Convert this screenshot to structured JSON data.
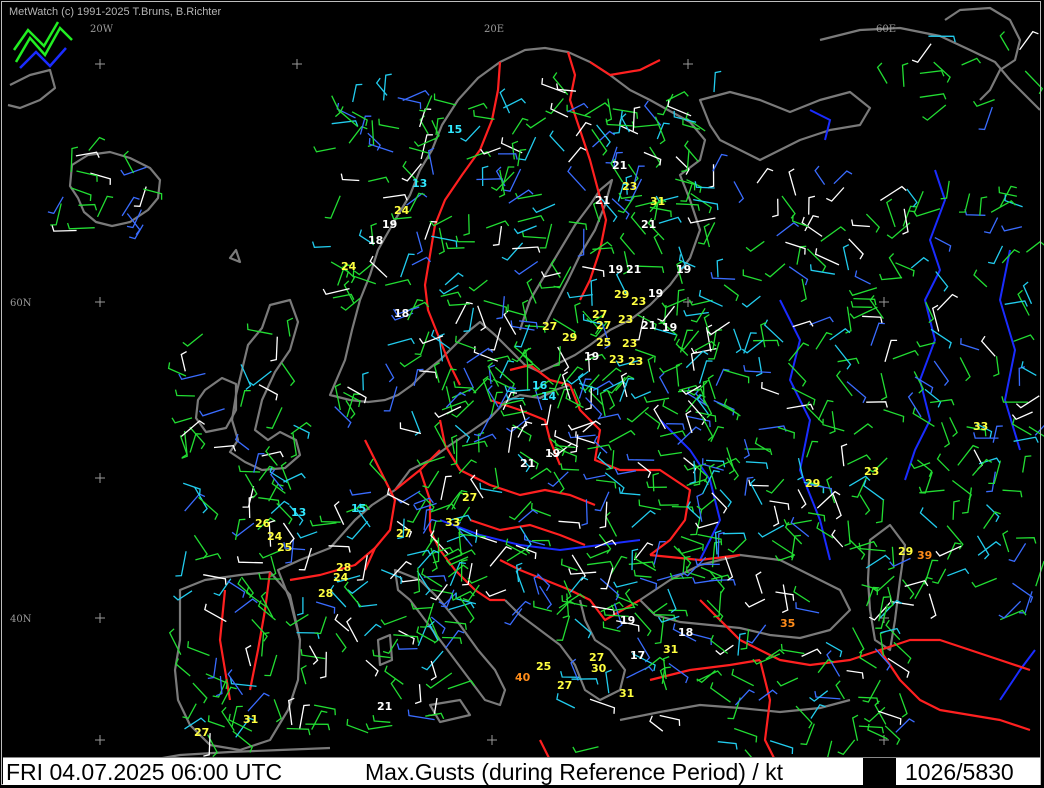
{
  "copyright": "MetWatch  (c) 1991-2025 T.Bruns, B.Richter",
  "footer": {
    "datetime": "FRI 04.07.2025 06:00 UTC",
    "title": "Max.Gusts (during Reference Period) / kt",
    "station_count": "1026/5830"
  },
  "grid_labels": [
    "20W",
    "20E",
    "60E",
    "60N",
    "40N"
  ],
  "colors": {
    "background": "#000000",
    "coast": "#7a7a7a",
    "border": "#ff2020",
    "river": "#1a2cff",
    "barb_green": "#22dd33",
    "barb_cyan": "#22ccee",
    "barb_blue": "#3a6cff",
    "barb_white": "#ffffff",
    "value_white": "#ffffff",
    "value_yellow": "#ffff40",
    "value_cyan": "#30e8ff",
    "value_orange": "#ff8c1a"
  },
  "gust_values": [
    {
      "v": "15",
      "c": "cyan"
    },
    {
      "v": "13",
      "c": "cyan"
    },
    {
      "v": "24",
      "c": "yellow"
    },
    {
      "v": "19",
      "c": "white"
    },
    {
      "v": "18",
      "c": "white"
    },
    {
      "v": "24",
      "c": "yellow"
    },
    {
      "v": "18",
      "c": "white"
    },
    {
      "v": "21",
      "c": "white"
    },
    {
      "v": "23",
      "c": "yellow"
    },
    {
      "v": "21",
      "c": "white"
    },
    {
      "v": "31",
      "c": "yellow"
    },
    {
      "v": "21",
      "c": "white"
    },
    {
      "v": "19",
      "c": "white"
    },
    {
      "v": "21",
      "c": "white"
    },
    {
      "v": "19",
      "c": "white"
    },
    {
      "v": "29",
      "c": "yellow"
    },
    {
      "v": "23",
      "c": "yellow"
    },
    {
      "v": "19",
      "c": "white"
    },
    {
      "v": "27",
      "c": "yellow"
    },
    {
      "v": "27",
      "c": "yellow"
    },
    {
      "v": "27",
      "c": "yellow"
    },
    {
      "v": "23",
      "c": "yellow"
    },
    {
      "v": "21",
      "c": "white"
    },
    {
      "v": "19",
      "c": "white"
    },
    {
      "v": "29",
      "c": "yellow"
    },
    {
      "v": "25",
      "c": "yellow"
    },
    {
      "v": "23",
      "c": "yellow"
    },
    {
      "v": "19",
      "c": "white"
    },
    {
      "v": "23",
      "c": "yellow"
    },
    {
      "v": "23",
      "c": "yellow"
    },
    {
      "v": "16",
      "c": "cyan"
    },
    {
      "v": "14",
      "c": "cyan"
    },
    {
      "v": "19",
      "c": "white"
    },
    {
      "v": "21",
      "c": "white"
    },
    {
      "v": "27",
      "c": "yellow"
    },
    {
      "v": "13",
      "c": "cyan"
    },
    {
      "v": "15",
      "c": "cyan"
    },
    {
      "v": "26",
      "c": "yellow"
    },
    {
      "v": "24",
      "c": "yellow"
    },
    {
      "v": "25",
      "c": "yellow"
    },
    {
      "v": "27",
      "c": "yellow"
    },
    {
      "v": "33",
      "c": "yellow"
    },
    {
      "v": "28",
      "c": "yellow"
    },
    {
      "v": "24",
      "c": "yellow"
    },
    {
      "v": "28",
      "c": "yellow"
    },
    {
      "v": "33",
      "c": "yellow"
    },
    {
      "v": "29",
      "c": "yellow"
    },
    {
      "v": "23",
      "c": "yellow"
    },
    {
      "v": "29",
      "c": "yellow"
    },
    {
      "v": "39",
      "c": "orange"
    },
    {
      "v": "35",
      "c": "orange"
    },
    {
      "v": "19",
      "c": "white"
    },
    {
      "v": "18",
      "c": "white"
    },
    {
      "v": "31",
      "c": "yellow"
    },
    {
      "v": "17",
      "c": "white"
    },
    {
      "v": "27",
      "c": "yellow"
    },
    {
      "v": "30",
      "c": "yellow"
    },
    {
      "v": "25",
      "c": "yellow"
    },
    {
      "v": "40",
      "c": "orange"
    },
    {
      "v": "27",
      "c": "yellow"
    },
    {
      "v": "31",
      "c": "yellow"
    },
    {
      "v": "21",
      "c": "white"
    },
    {
      "v": "31",
      "c": "yellow"
    },
    {
      "v": "27",
      "c": "yellow"
    },
    {
      "v": "30",
      "c": "yellow"
    }
  ]
}
